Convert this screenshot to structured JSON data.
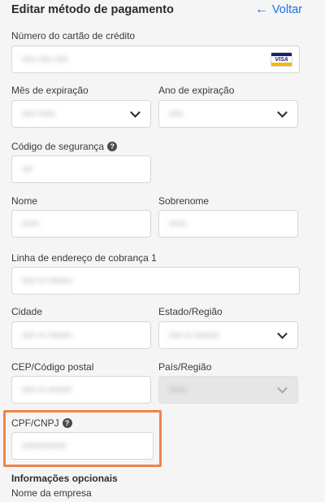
{
  "header": {
    "title": "Editar método de pagamento",
    "back_arrow": "←",
    "back_label": "Voltar"
  },
  "card": {
    "label": "Número do cartão de crédito",
    "value": "•••• •••• ••••",
    "brand": "VISA"
  },
  "expiry_month": {
    "label": "Mês de expiração",
    "value": "•••• •••••"
  },
  "expiry_year": {
    "label": "Ano de expiração",
    "value": "••••"
  },
  "security_code": {
    "label": "Código de segurança",
    "help": "?",
    "value": "•••"
  },
  "first_name": {
    "label": "Nome",
    "value": "•••••"
  },
  "last_name": {
    "label": "Sobrenome",
    "value": "•••••"
  },
  "address_line1": {
    "label": "Linha de endereço de cobrança 1",
    "value": "•••• •• •••••••"
  },
  "city": {
    "label": "Cidade",
    "value": "•••• •• •••••••"
  },
  "state": {
    "label": "Estado/Região",
    "value": "•••• •• •••••••"
  },
  "postal_code": {
    "label": "CEP/Código postal",
    "value": "•••• •• •••••••"
  },
  "country": {
    "label": "País/Região",
    "value": "•••••"
  },
  "tax_id": {
    "label": "CPF/CNPJ",
    "help": "?",
    "value": "•••••••••••••"
  },
  "optional": {
    "heading": "Informações opcionais",
    "company_label": "Nome da empresa"
  },
  "colors": {
    "accent": "#1473e6",
    "highlight": "#f0834a",
    "background": "#f5f5f5"
  }
}
